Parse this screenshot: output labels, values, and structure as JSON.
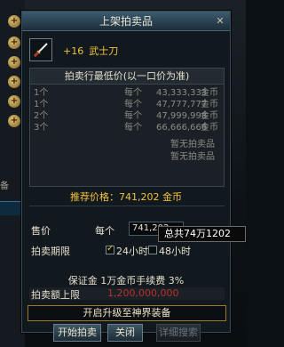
{
  "dialog": {
    "title": "上架拍卖品",
    "close_glyph": "✕"
  },
  "item": {
    "enhance_level": "+16",
    "name": "武士刀",
    "icon": "katana-icon"
  },
  "price_list": {
    "header": "拍卖行最低价(以一口价为准)",
    "rows": [
      {
        "qty": "1个",
        "each": "每个",
        "price": "43,333,333",
        "currency": "金币"
      },
      {
        "qty": "1个",
        "each": "每个",
        "price": "47,777,777",
        "currency": "金币"
      },
      {
        "qty": "2个",
        "each": "每个",
        "price": "47,999,998",
        "currency": "金币"
      },
      {
        "qty": "3个",
        "each": "每个",
        "price": "66,666,666",
        "currency": "金币"
      }
    ],
    "empty_rows": [
      "暂无拍卖品",
      "暂无拍卖品"
    ]
  },
  "recommend": "推荐价格：741,202 金币",
  "sell": {
    "price_label": "售价",
    "each_label": "每个",
    "price_value": "741,202",
    "tooltip": "总共74万1202"
  },
  "duration": {
    "label": "拍卖期限",
    "option_24": "24小时",
    "option_48": "48小时",
    "selected": "24小时"
  },
  "deposit": "保证金  1万金币手续费  3%",
  "limit": {
    "label": "拍卖额上限",
    "value": "1,200,000,000"
  },
  "banner": "开启升级至神界装备",
  "buttons": {
    "start": "开始拍卖",
    "close": "关闭",
    "detail": "详细搜索"
  },
  "side": {
    "partial_text": "备"
  },
  "colors": {
    "gold": "#f2c23a",
    "title_bar": "#2c4454",
    "limit_value": "#b8312f"
  }
}
